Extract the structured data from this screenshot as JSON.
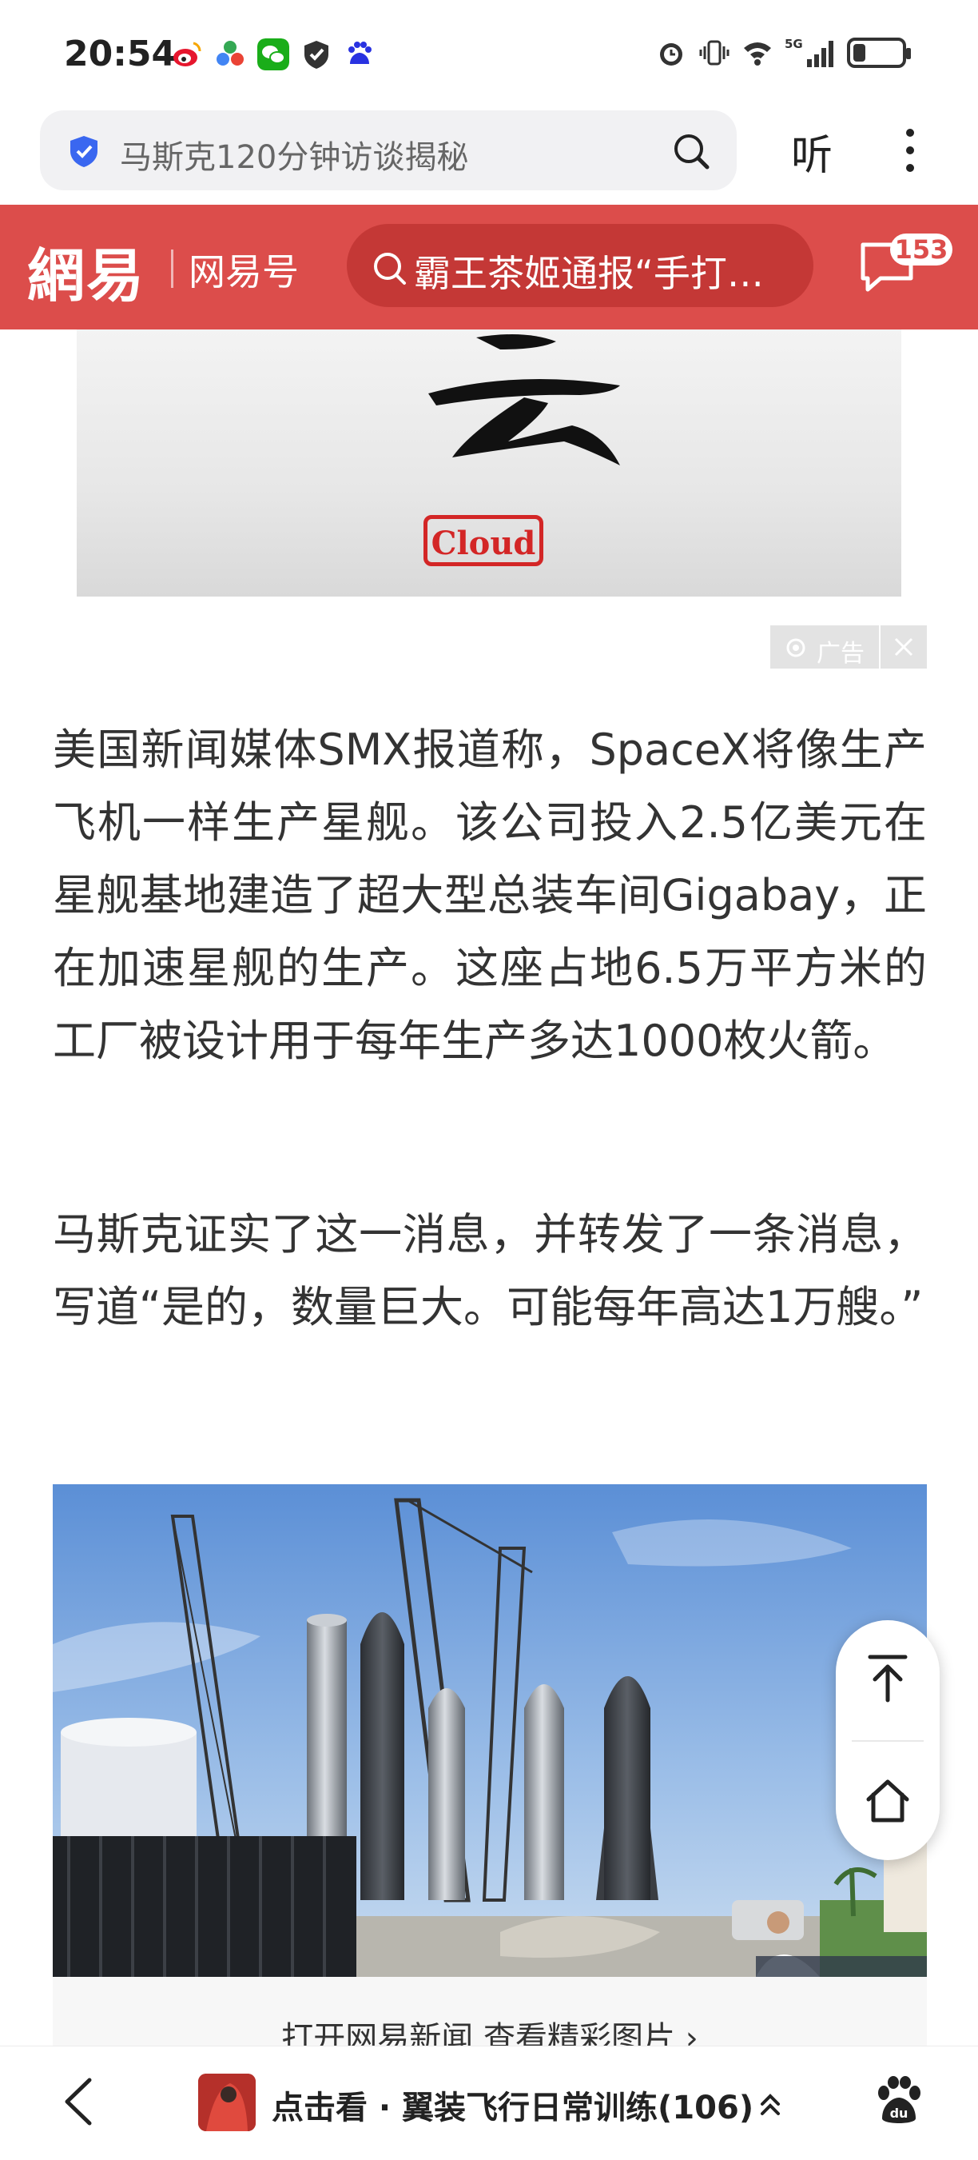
{
  "status_bar": {
    "time": "20:54",
    "left_icons": [
      "weibo-icon",
      "colorful-app-icon",
      "wechat-icon",
      "shield-check-icon",
      "baidu-paw-icon"
    ],
    "right_icons": [
      "alarm-icon",
      "vibrate-icon",
      "wifi-icon",
      "signal-5g-icon",
      "battery-icon"
    ],
    "network": "5G",
    "battery_level": 0.25
  },
  "browser": {
    "search_text": "马斯克120分钟访谈揭秘",
    "listen_label": "听"
  },
  "netease": {
    "logo": "網易",
    "sub_brand": "网易号",
    "hot_search": "霸王茶姬通报“手打…",
    "message_count": "153",
    "brand_color": "#dc4d4b"
  },
  "ad": {
    "stamp_text": "Cloud",
    "tag_label": "广告"
  },
  "article": {
    "paragraphs": [
      "美国新闻媒体SMX报道称，SpaceX将像生产飞机一样生产星舰。该公司投入2.5亿美元在星舰基地建造了超大型总装车间Gigabay，正在加速星舰的生产。这座占地6.5万平方米的工厂被设计用于每年生产多达1000枚火箭。",
      "马斯克证实了这一消息，并转发了一条消息，写道“是的，数量巨大。可能每年高达1万艘。”"
    ],
    "photo_cta": "打开网易新闻 查看精彩图片 ›"
  },
  "bottom_bar": {
    "title": "点击看 · 翼装飞行日常训练(106)"
  }
}
